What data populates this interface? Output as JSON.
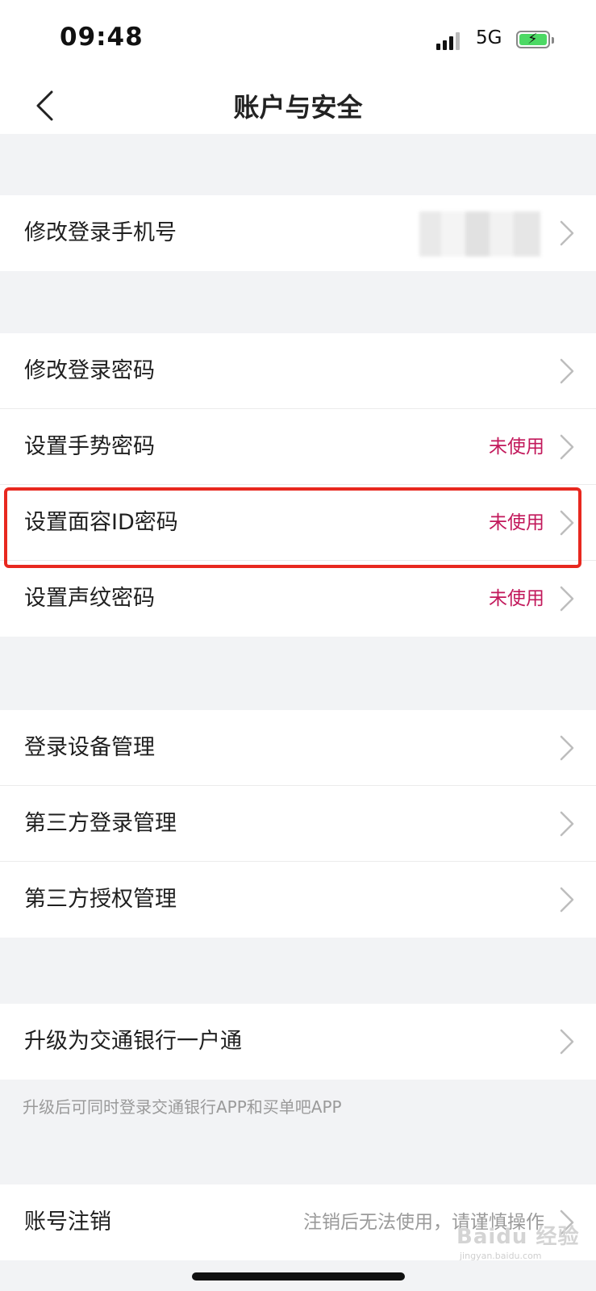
{
  "status_bar": {
    "time": "09:48",
    "network": "5G"
  },
  "nav": {
    "title": "账户与安全"
  },
  "groups": [
    {
      "items": [
        {
          "label": "修改登录手机号",
          "value": ""
        }
      ]
    },
    {
      "items": [
        {
          "label": "修改登录密码",
          "value": ""
        },
        {
          "label": "设置手势密码",
          "value": "未使用"
        },
        {
          "label": "设置面容ID密码",
          "value": "未使用"
        },
        {
          "label": "设置声纹密码",
          "value": "未使用"
        }
      ]
    },
    {
      "items": [
        {
          "label": "登录设备管理",
          "value": ""
        },
        {
          "label": "第三方登录管理",
          "value": ""
        },
        {
          "label": "第三方授权管理",
          "value": ""
        }
      ]
    },
    {
      "items": [
        {
          "label": "升级为交通银行一户通",
          "value": ""
        }
      ]
    },
    {
      "items": [
        {
          "label": "账号注销",
          "value": "注销后无法使用，请谨慎操作"
        }
      ]
    }
  ],
  "upgrade_note": "升级后可同时登录交通银行APP和买单吧APP",
  "watermark": {
    "brand": "Baidu 经验",
    "url": "jingyan.baidu.com"
  },
  "colors": {
    "accent_value": "#c2185b",
    "highlight_border": "#e8281f",
    "page_background": "#f2f3f5"
  }
}
